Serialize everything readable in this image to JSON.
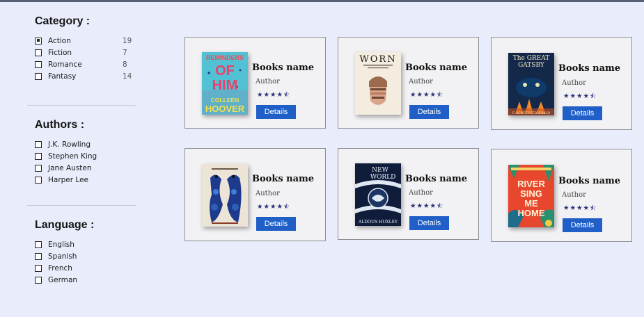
{
  "filters": {
    "category": {
      "title": "Category :",
      "items": [
        {
          "label": "Action",
          "count": "19",
          "checked": true
        },
        {
          "label": "Fiction",
          "count": "7",
          "checked": false
        },
        {
          "label": "Romance",
          "count": "8",
          "checked": false
        },
        {
          "label": "Fantasy",
          "count": "14",
          "checked": false
        }
      ]
    },
    "authors": {
      "title": "Authors :",
      "items": [
        {
          "label": "J.K. Rowling"
        },
        {
          "label": "Stephen King"
        },
        {
          "label": "Jane Austen"
        },
        {
          "label": "Harper Lee"
        }
      ]
    },
    "language": {
      "title": "Language :",
      "items": [
        {
          "label": "English"
        },
        {
          "label": "Spanish"
        },
        {
          "label": "French"
        },
        {
          "label": "German"
        }
      ]
    }
  },
  "books": [
    {
      "title": "Books name",
      "author": "Author",
      "rating": "★★★★⯪",
      "button": "Details",
      "cover_text": [
        "REMINDERS",
        "OF",
        "HIM",
        "COLLEEN",
        "HOOVER"
      ]
    },
    {
      "title": "Books name",
      "author": "Author",
      "rating": "★★★★⯪",
      "button": "Details",
      "cover_text": [
        "WORN"
      ]
    },
    {
      "title": "Books name",
      "author": "Author",
      "rating": "★★★★⯪",
      "button": "Details",
      "cover_text": [
        "The GREAT",
        "GATSBY",
        "F. SCOTT FITZGERALD"
      ]
    },
    {
      "title": "Books name",
      "author": "Author",
      "rating": "★★★★⯪",
      "button": "Details",
      "cover_text": []
    },
    {
      "title": "Books name",
      "author": "Author",
      "rating": "★★★★⯪",
      "button": "Details",
      "cover_text": [
        "NEW",
        "WORLD",
        "ALDOUS HUXLEY"
      ]
    },
    {
      "title": "Books name",
      "author": "Author",
      "rating": "★★★★⯪",
      "button": "Details",
      "cover_text": [
        "RIVER",
        "SING",
        "ME",
        "HOME"
      ]
    }
  ],
  "colors": {
    "accent": "#1f5fc7",
    "background": "#e8ecfb",
    "card": "#f2f2f4",
    "star": "#2a2f7a"
  }
}
